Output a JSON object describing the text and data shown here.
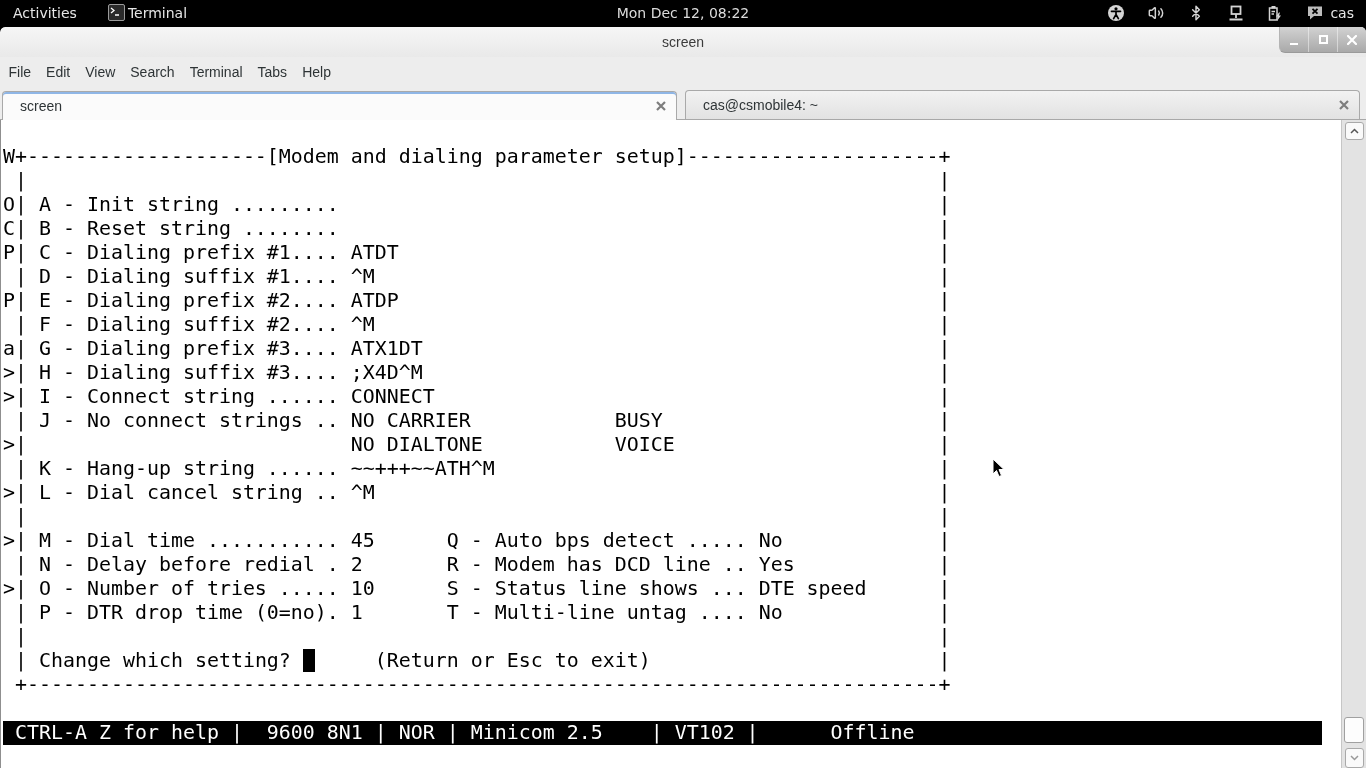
{
  "top_bar": {
    "activities": "Activities",
    "app_menu": "Terminal",
    "clock": "Mon Dec 12, 08:22",
    "user": "cas"
  },
  "window": {
    "title": "screen"
  },
  "menu": [
    "File",
    "Edit",
    "View",
    "Search",
    "Terminal",
    "Tabs",
    "Help"
  ],
  "tabs": [
    {
      "label": "screen",
      "selected": true
    },
    {
      "label": "cas@csmobile4: ~",
      "selected": false
    }
  ],
  "terminal": {
    "lines": [
      "W+--------------------[Modem and dialing parameter setup]---------------------+",
      " |                                                                            |",
      "O| A - Init string .........                                                  |",
      "C| B - Reset string ........                                                  |",
      "P| C - Dialing prefix #1.... ATDT                                             |",
      " | D - Dialing suffix #1.... ^M                                               |",
      "P| E - Dialing prefix #2.... ATDP                                             |",
      " | F - Dialing suffix #2.... ^M                                               |",
      "a| G - Dialing prefix #3.... ATX1DT                                           |",
      ">| H - Dialing suffix #3.... ;X4D^M                                           |",
      ">| I - Connect string ...... CONNECT                                          |",
      " | J - No connect strings .. NO CARRIER            BUSY                       |",
      ">|                           NO DIALTONE           VOICE                      |",
      " | K - Hang-up string ...... ~~+++~~ATH^M                                     |",
      ">| L - Dial cancel string .. ^M                                               |",
      " |                                                                            |",
      ">| M - Dial time ........... 45      Q - Auto bps detect ..... No             |",
      " | N - Delay before redial . 2       R - Modem has DCD line .. Yes            |",
      ">| O - Number of tries ..... 10      S - Status line shows ... DTE speed      |",
      " | P - DTR drop time (0=no). 1       T - Multi-line untag .... No             |",
      " |                                                                            |"
    ],
    "prompt": {
      "text": " | Change which setting? ",
      "cursor": true,
      "after": "     (Return or Esc to exit)                        |"
    },
    "bottom_border": " +----------------------------------------------------------------------------+",
    "status_line": "CTRL-A Z for help |  9600 8N1 | NOR | Minicom 2.5    | VT102 |      Offline"
  }
}
